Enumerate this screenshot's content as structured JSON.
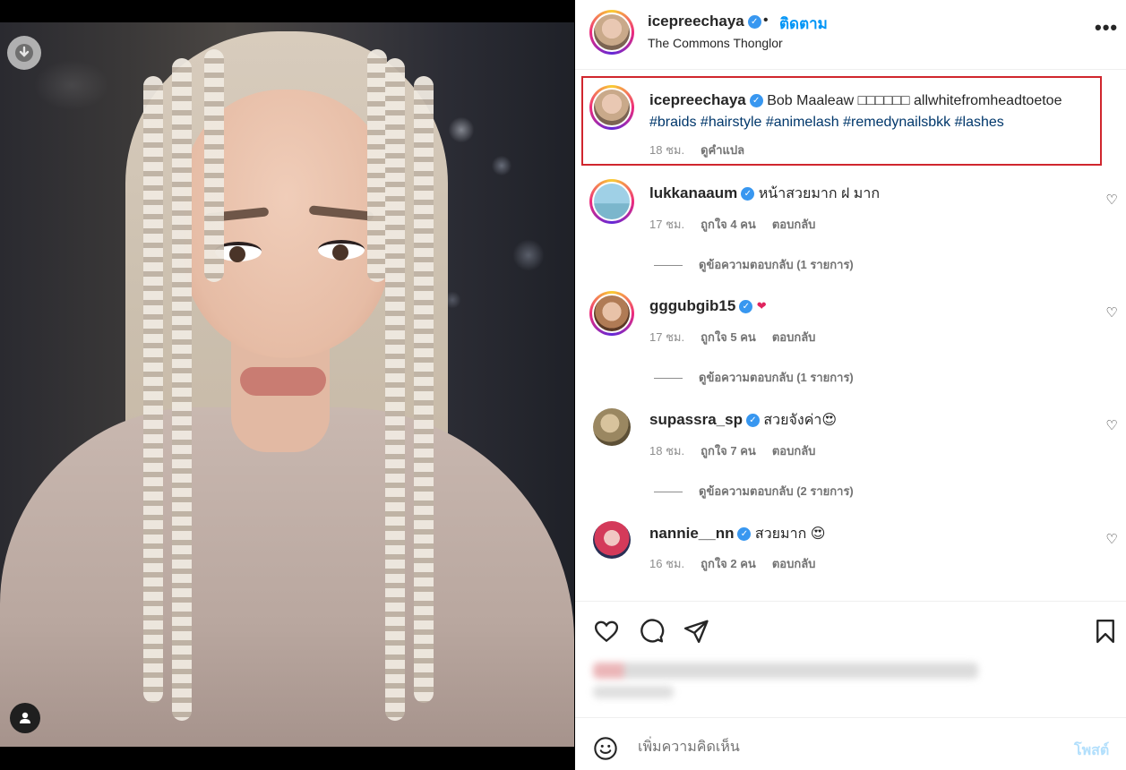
{
  "header": {
    "username": "icepreechaya",
    "separator": "•",
    "follow_label": "ติดตาม",
    "location": "The Commons Thonglor",
    "more_label": "•••"
  },
  "caption": {
    "username": "icepreechaya",
    "text": "Bob Maaleaw □□□□□□ allwhitefromheadtoetoe",
    "hashtags": "#braids #hairstyle #animelash #remedynailsbkk #lashes",
    "time": "18 ชม.",
    "translate_label": "ดูคำแปล"
  },
  "comments": [
    {
      "username": "lukkanaaum",
      "text": "หน้าสวยมาก ฝ มาก",
      "time": "17 ชม.",
      "likes": "ถูกใจ 4 คน",
      "reply_label": "ตอบกลับ",
      "view_replies": "ดูข้อความตอบกลับ (1 รายการ)"
    },
    {
      "username": "gggubgib15",
      "text": "❤",
      "time": "17 ชม.",
      "likes": "ถูกใจ 5 คน",
      "reply_label": "ตอบกลับ",
      "view_replies": "ดูข้อความตอบกลับ (1 รายการ)"
    },
    {
      "username": "supassra_sp",
      "text": "สวยจังค่า😍",
      "time": "18 ชม.",
      "likes": "ถูกใจ 7 คน",
      "reply_label": "ตอบกลับ",
      "view_replies": "ดูข้อความตอบกลับ (2 รายการ)"
    },
    {
      "username": "nannie__nn",
      "text": "สวยมาก 😍",
      "time": "16 ชม.",
      "likes": "ถูกใจ 2 คน",
      "reply_label": "ตอบกลับ"
    }
  ],
  "icons": {
    "verified": "✓",
    "heart_small": "♡",
    "download": "↓"
  },
  "comment_bar": {
    "placeholder": "เพิ่มความคิดเห็น",
    "post_label": "โพสต์"
  },
  "colors": {
    "link_blue": "#0095f6",
    "verified_blue": "#3897f0",
    "highlight_red": "#d0262e",
    "hashtag_navy": "#00376b",
    "post_disabled": "#b2dffc"
  }
}
